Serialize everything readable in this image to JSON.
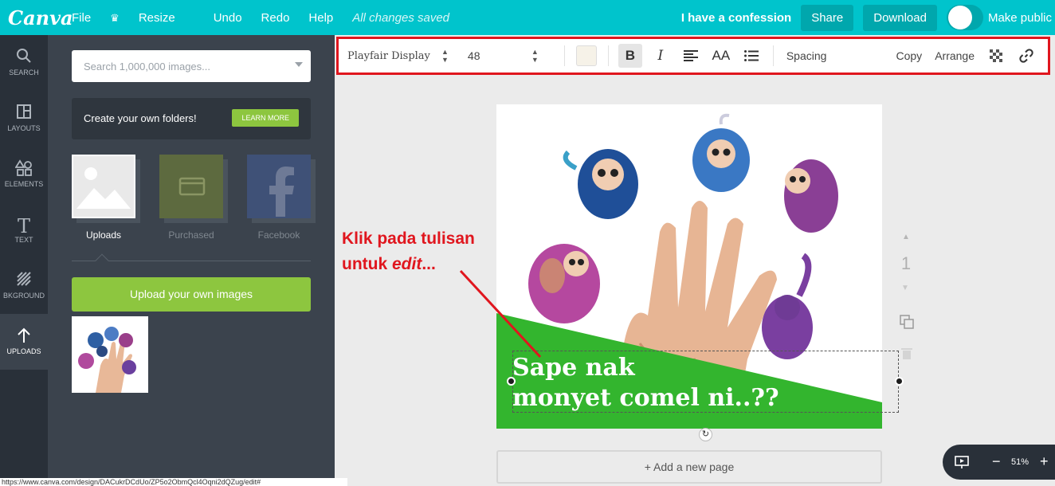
{
  "app": {
    "logo": "Canva"
  },
  "menu": [
    {
      "label": "File"
    },
    {
      "label": "Resize"
    },
    {
      "label": "Undo"
    },
    {
      "label": "Redo"
    },
    {
      "label": "Help"
    }
  ],
  "save_status": "All changes saved",
  "design_title": "I have a confession",
  "share_label": "Share",
  "download_label": "Download",
  "make_public_label": "Make public",
  "rail": [
    {
      "label": "SEARCH",
      "icon": "search-icon"
    },
    {
      "label": "LAYOUTS",
      "icon": "layouts-icon"
    },
    {
      "label": "ELEMENTS",
      "icon": "elements-icon"
    },
    {
      "label": "TEXT",
      "icon": "text-icon"
    },
    {
      "label": "BKGROUND",
      "icon": "background-icon"
    },
    {
      "label": "UPLOADS",
      "icon": "upload-icon"
    }
  ],
  "panel": {
    "search_placeholder": "Search 1,000,000 images...",
    "folders_text": "Create your own folders!",
    "learn_more": "LEARN MORE",
    "tiles": [
      {
        "label": "Uploads"
      },
      {
        "label": "Purchased"
      },
      {
        "label": "Facebook"
      }
    ],
    "upload_button": "Upload your own images"
  },
  "toolbar": {
    "font": "Playfair Display",
    "size": "48",
    "spacing": "Spacing",
    "copy": "Copy",
    "arrange": "Arrange"
  },
  "design": {
    "line1": "Sape nak",
    "line2": "monyet comel ni..??"
  },
  "annotation": {
    "line1": "Klik pada tulisan",
    "line2_prefix": "untuk ",
    "line2_em": "edit",
    "line2_suffix": "..."
  },
  "page_number": "1",
  "add_page": "+ Add a new page",
  "zoom": "51%",
  "status_url": "https://www.canva.com/design/DACukrDCdUo/ZP5o2ObmQcl4Oqni2dQZug/edit#",
  "colors": {
    "topbar": "#00c4cc",
    "rail": "#293039",
    "panel": "#3b434d",
    "accent_green": "#8dc63f",
    "annotation_red": "#e0161e",
    "design_green": "#33b52e"
  }
}
